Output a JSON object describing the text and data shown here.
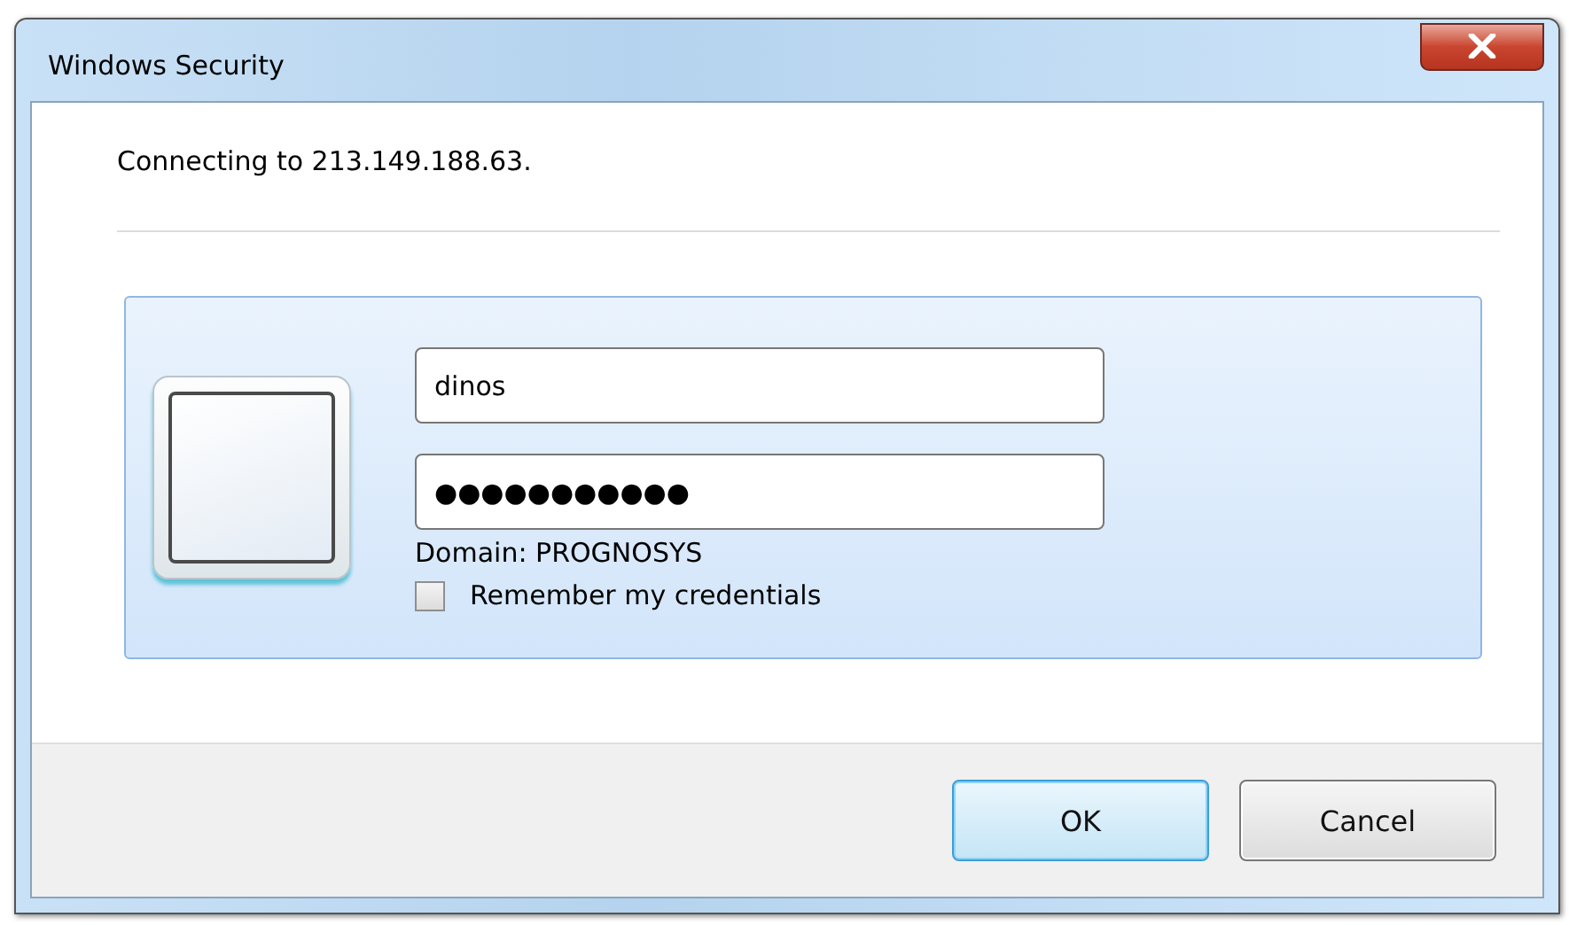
{
  "window": {
    "title": "Windows Security"
  },
  "message": "Connecting to 213.149.188.63.",
  "credentials": {
    "username": "dinos",
    "password": "●●●●●●●●●●●",
    "domain": "Domain: PROGNOSYS",
    "remember": {
      "label": "Remember my credentials",
      "checked": false
    }
  },
  "buttons": [
    {
      "label": "OK",
      "default": true
    },
    {
      "label": "Cancel",
      "default": false
    }
  ]
}
